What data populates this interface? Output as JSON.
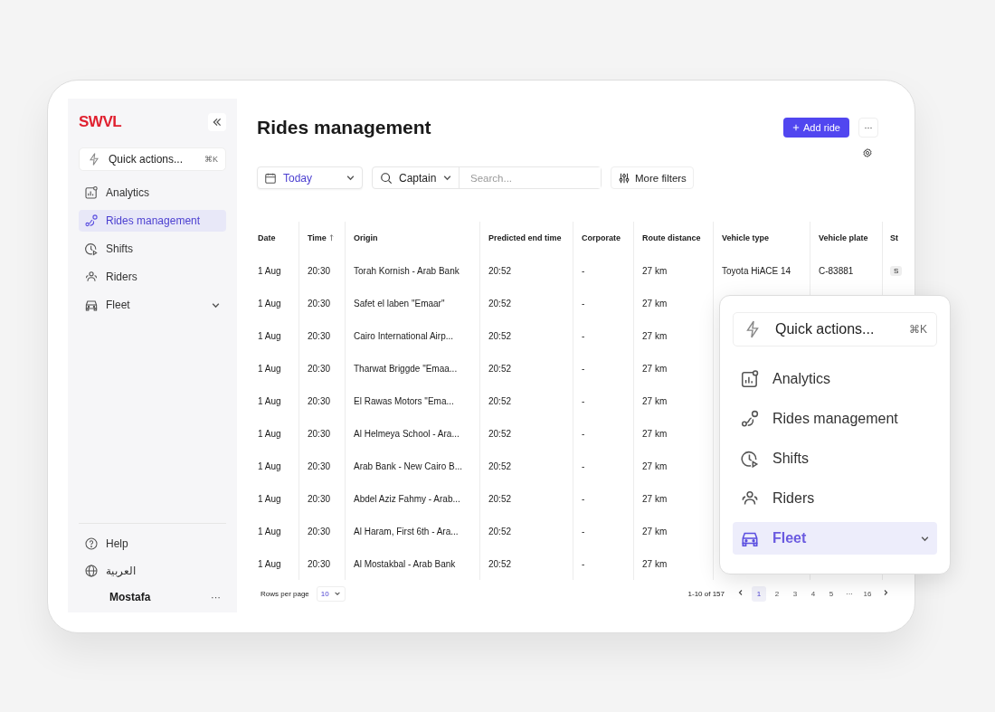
{
  "sidebar": {
    "logo": "SWVL",
    "quick_actions": {
      "label": "Quick actions...",
      "shortcut": "⌘K"
    },
    "items": [
      {
        "label": "Analytics",
        "selected": false,
        "expandable": false
      },
      {
        "label": "Rides management",
        "selected": true,
        "expandable": false
      },
      {
        "label": "Shifts",
        "selected": false,
        "expandable": false
      },
      {
        "label": "Riders",
        "selected": false,
        "expandable": false
      },
      {
        "label": "Fleet",
        "selected": false,
        "expandable": true
      }
    ],
    "footer": [
      {
        "label": "Help"
      },
      {
        "label": "العربية"
      }
    ],
    "user": {
      "name": "Mostafa",
      "more": "···"
    }
  },
  "header": {
    "title": "Rides management",
    "add_button": "Add ride",
    "more_button": "···"
  },
  "filters": {
    "date": "Today",
    "search_by": "Captain",
    "search": {
      "placeholder": "Search..."
    },
    "more_filters": "More filters"
  },
  "table": {
    "columns": [
      {
        "label": "Date",
        "sorted": false
      },
      {
        "label": "Time",
        "sorted": true
      },
      {
        "label": "Origin",
        "sorted": false
      },
      {
        "label": "Predicted end time",
        "sorted": false
      },
      {
        "label": "Corporate",
        "sorted": false
      },
      {
        "label": "Route distance",
        "sorted": false
      },
      {
        "label": "Vehicle type",
        "sorted": false
      },
      {
        "label": "Vehicle plate",
        "sorted": false
      },
      {
        "label": "St",
        "sorted": false
      }
    ],
    "rows": [
      {
        "cells": [
          "1 Aug",
          "20:30",
          "Torah Kornish - Arab Bank",
          "20:52",
          "-",
          "27 km",
          "Toyota HiACE 14",
          "C-83881",
          "S"
        ]
      },
      {
        "cells": [
          "1 Aug",
          "20:30",
          "Safet el laben  \"Emaar\"",
          "20:52",
          "-",
          "27 km"
        ]
      },
      {
        "cells": [
          "1 Aug",
          "20:30",
          "Cairo International Airp...",
          "20:52",
          "-",
          "27 km"
        ]
      },
      {
        "cells": [
          "1 Aug",
          "20:30",
          "Tharwat Briggde \"Emaa...",
          "20:52",
          "-",
          "27 km"
        ]
      },
      {
        "cells": [
          "1 Aug",
          "20:30",
          "El Rawas Motors  \"Ema...",
          "20:52",
          "-",
          "27 km"
        ]
      },
      {
        "cells": [
          "1 Aug",
          "20:30",
          "Al Helmeya School - Ara...",
          "20:52",
          "-",
          "27 km"
        ]
      },
      {
        "cells": [
          "1 Aug",
          "20:30",
          "Arab Bank - New Cairo B...",
          "20:52",
          "-",
          "27 km"
        ]
      },
      {
        "cells": [
          "1 Aug",
          "20:30",
          "Abdel Aziz Fahmy - Arab...",
          "20:52",
          "-",
          "27 km"
        ]
      },
      {
        "cells": [
          "1 Aug",
          "20:30",
          "Al Haram, First 6th - Ara...",
          "20:52",
          "-",
          "27 km"
        ]
      },
      {
        "cells": [
          "1 Aug",
          "20:30",
          "Al Mostakbal - Arab Bank",
          "20:52",
          "-",
          "27 km"
        ]
      }
    ]
  },
  "pagination": {
    "rows_label": "Rows per page",
    "rows_value": "10",
    "range": "1-10 of 157",
    "pages": [
      {
        "label": "1",
        "selected": true
      },
      {
        "label": "2",
        "selected": false
      },
      {
        "label": "3",
        "selected": false
      },
      {
        "label": "4",
        "selected": false
      },
      {
        "label": "5",
        "selected": false
      },
      {
        "label": "···",
        "selected": false
      },
      {
        "label": "16",
        "selected": false
      }
    ]
  },
  "popup": {
    "quick_actions": {
      "label": "Quick actions...",
      "shortcut": "⌘K"
    },
    "items": [
      {
        "label": "Analytics",
        "selected": false,
        "expandable": false
      },
      {
        "label": "Rides management",
        "selected": false,
        "expandable": false
      },
      {
        "label": "Shifts",
        "selected": false,
        "expandable": false
      },
      {
        "label": "Riders",
        "selected": false,
        "expandable": false
      },
      {
        "label": "Fleet",
        "selected": true,
        "expandable": true
      }
    ]
  }
}
